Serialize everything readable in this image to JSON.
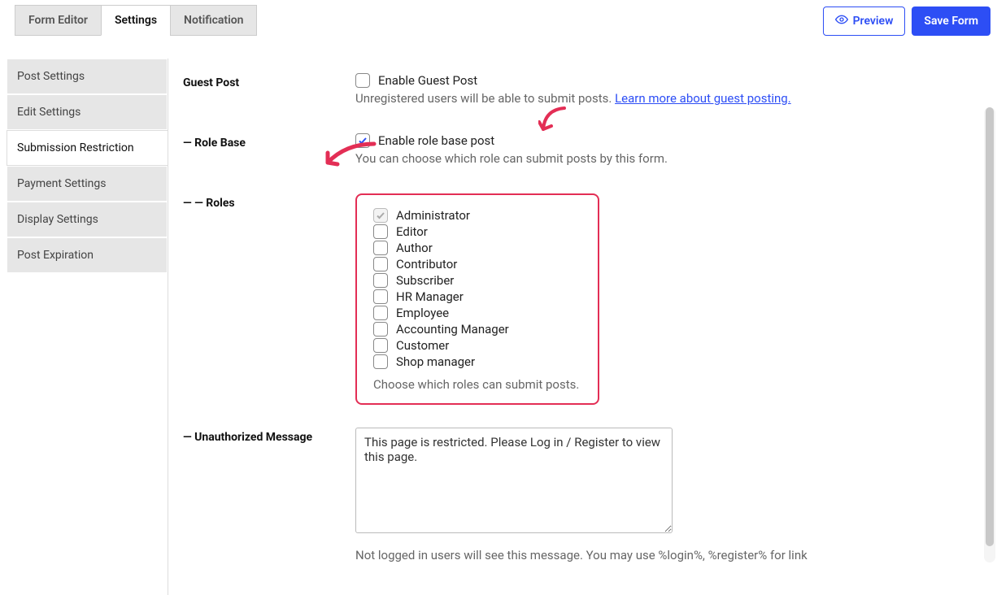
{
  "tabs": {
    "formEditor": "Form Editor",
    "settings": "Settings",
    "notification": "Notification"
  },
  "actions": {
    "preview": "Preview",
    "save": "Save Form"
  },
  "sidebar": {
    "postSettings": "Post Settings",
    "editSettings": "Edit Settings",
    "submissionRestriction": "Submission Restriction",
    "paymentSettings": "Payment Settings",
    "displaySettings": "Display Settings",
    "postExpiration": "Post Expiration"
  },
  "guestPost": {
    "label": "Guest Post",
    "checkbox": "Enable Guest Post",
    "help": "Unregistered users will be able to submit posts. ",
    "link": "Learn more about guest posting."
  },
  "roleBase": {
    "label": "— Role Base",
    "checkbox": "Enable role base post",
    "help": "You can choose which role can submit posts by this form."
  },
  "roles": {
    "label": "— — Roles",
    "items": [
      {
        "name": "Administrator",
        "checked": true,
        "disabled": true
      },
      {
        "name": "Editor",
        "checked": false,
        "disabled": false
      },
      {
        "name": "Author",
        "checked": false,
        "disabled": false
      },
      {
        "name": "Contributor",
        "checked": false,
        "disabled": false
      },
      {
        "name": "Subscriber",
        "checked": false,
        "disabled": false
      },
      {
        "name": "HR Manager",
        "checked": false,
        "disabled": false
      },
      {
        "name": "Employee",
        "checked": false,
        "disabled": false
      },
      {
        "name": "Accounting Manager",
        "checked": false,
        "disabled": false
      },
      {
        "name": "Customer",
        "checked": false,
        "disabled": false
      },
      {
        "name": "Shop manager",
        "checked": false,
        "disabled": false
      }
    ],
    "help": "Choose which roles can submit posts."
  },
  "unauth": {
    "label": "— Unauthorized Message",
    "value": "This page is restricted. Please Log in / Register to view this page.",
    "help": "Not logged in users will see this message. You may use %login%, %register% for link"
  }
}
